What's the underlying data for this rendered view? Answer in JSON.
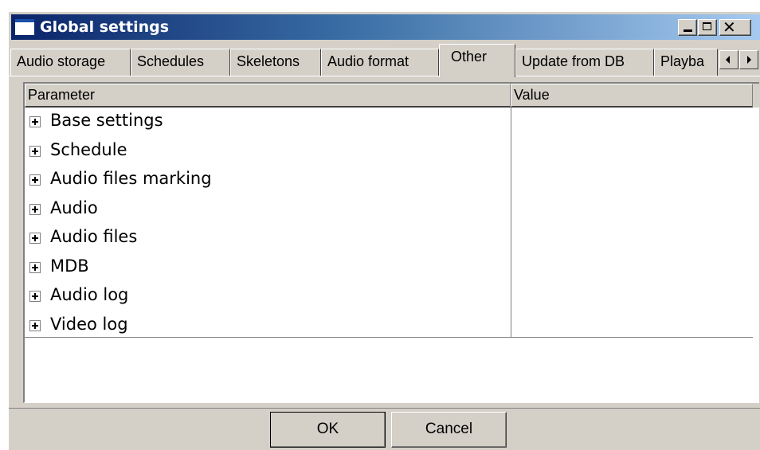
{
  "window": {
    "title": "Global settings"
  },
  "tabs": [
    {
      "label": "Audio storage",
      "active": false
    },
    {
      "label": "Schedules",
      "active": false
    },
    {
      "label": "Skeletons",
      "active": false
    },
    {
      "label": "Audio format",
      "active": false
    },
    {
      "label": "Other",
      "active": true
    },
    {
      "label": "Update from DB",
      "active": false
    },
    {
      "label": "Playba",
      "active": false
    }
  ],
  "grid": {
    "columns": [
      "Parameter",
      "Value"
    ],
    "rows": [
      {
        "parameter": "Base settings",
        "value": ""
      },
      {
        "parameter": "Schedule",
        "value": ""
      },
      {
        "parameter": "Audio files marking",
        "value": ""
      },
      {
        "parameter": "Audio",
        "value": ""
      },
      {
        "parameter": "Audio files",
        "value": ""
      },
      {
        "parameter": "MDB",
        "value": ""
      },
      {
        "parameter": "Audio log",
        "value": ""
      },
      {
        "parameter": "Video log",
        "value": ""
      }
    ]
  },
  "buttons": {
    "ok": "OK",
    "cancel": "Cancel"
  },
  "icons": {
    "window": "window-icon",
    "minimize": "minimize-icon",
    "maximize": "maximize-icon",
    "close": "close-icon",
    "tab_scroll_left": "arrow-left-icon",
    "tab_scroll_right": "arrow-right-icon",
    "expander": "plus-box-icon"
  },
  "colors": {
    "titlebar_start": "#0a246a",
    "titlebar_end": "#a6caf0",
    "face": "#d4d0c8"
  }
}
